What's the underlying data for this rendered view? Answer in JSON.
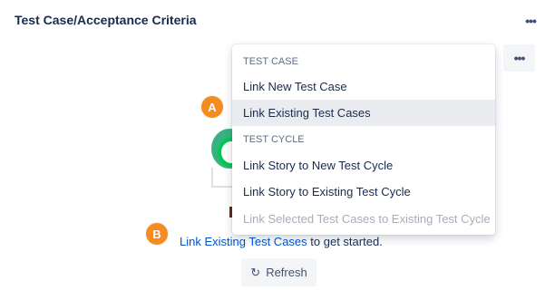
{
  "panel": {
    "title": "Test Case/Acceptance Criteria",
    "top_more_glyph": "•••",
    "more_glyph": "•••"
  },
  "menu": {
    "groups": [
      {
        "heading": "TEST CASE",
        "items": [
          {
            "label": "Link New Test Case",
            "state": "normal"
          },
          {
            "label": "Link Existing Test Cases",
            "state": "hover"
          }
        ]
      },
      {
        "heading": "TEST CYCLE",
        "items": [
          {
            "label": "Link Story to New Test Cycle",
            "state": "normal"
          },
          {
            "label": "Link Story to Existing Test Cycle",
            "state": "normal"
          },
          {
            "label": "Link Selected Test Cases to Existing Test Cycle",
            "state": "disabled"
          }
        ]
      }
    ]
  },
  "annotations": {
    "a": "A",
    "b": "B"
  },
  "empty_state": {
    "link_text": "Link Existing Test Cases",
    "suffix": "to get started."
  },
  "refresh": {
    "label": "Refresh",
    "icon": "refresh-icon"
  },
  "colors": {
    "link": "#0052cc",
    "badge": "#f68b1f",
    "hover_bg": "#ebecf0",
    "disabled_text": "#a5adba"
  }
}
